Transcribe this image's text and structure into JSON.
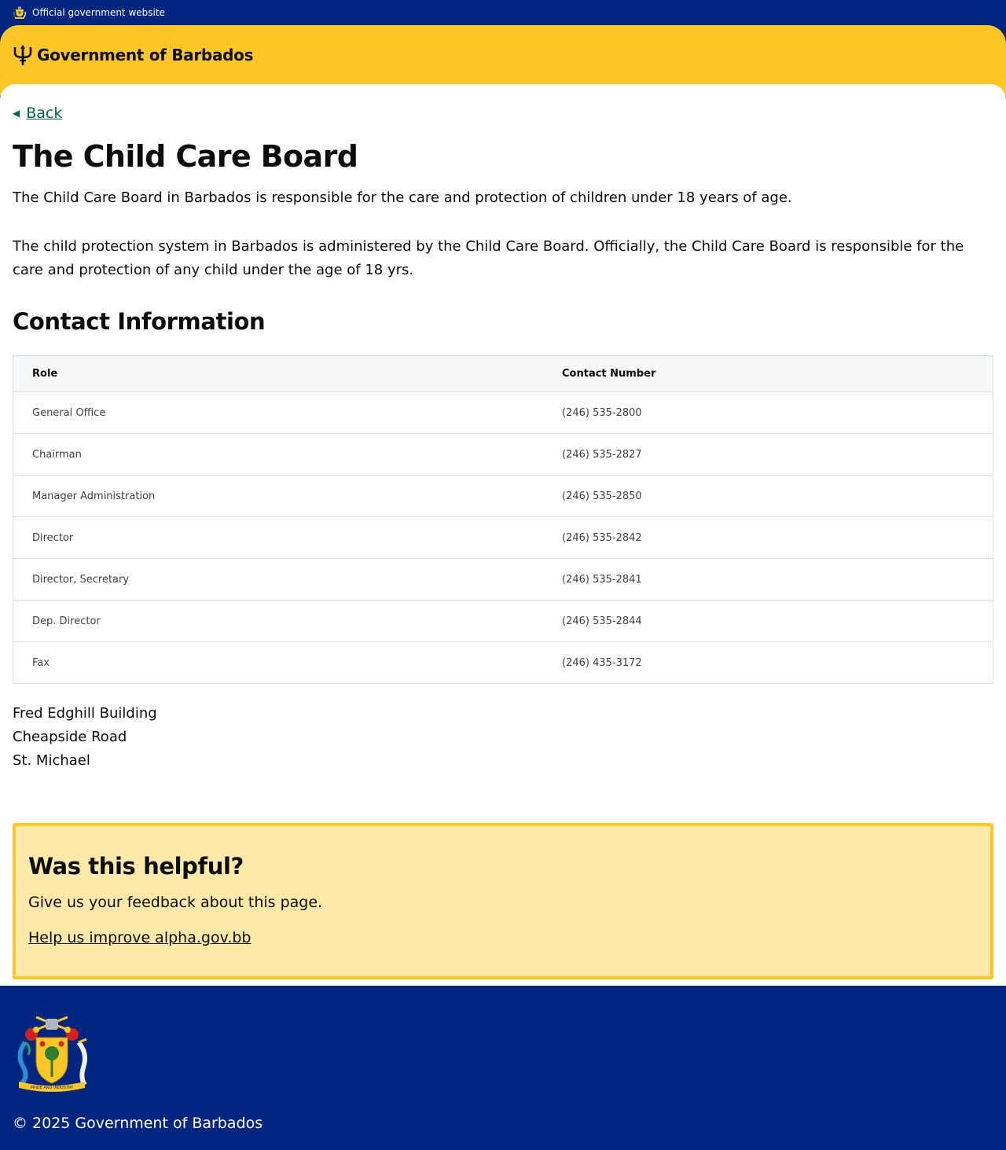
{
  "official_bar": {
    "text": "Official government website",
    "crest_icon": "barbados-crest-icon"
  },
  "header": {
    "brand": "Government of Barbados",
    "logo_icon": "trident-icon",
    "background": "#FFC726"
  },
  "nav": {
    "back_label": "Back",
    "back_icon": "arrow-left-icon"
  },
  "page": {
    "title": "The Child Care Board",
    "paragraphs": [
      "The Child Care Board in Barbados is responsible for the care and protection of children under 18 years of age.",
      "The child protection system in Barbados is administered by the Child Care Board. Officially, the Child Care Board is responsible for the care and protection of any child under the age of 18 yrs."
    ],
    "contact_heading": "Contact Information"
  },
  "contact_table": {
    "headers": [
      "Role",
      "Contact Number"
    ],
    "rows": [
      [
        "General Office",
        "(246) 535-2800"
      ],
      [
        "Chairman",
        "(246) 535-2827"
      ],
      [
        "Manager Administration",
        "(246) 535-2850"
      ],
      [
        "Director",
        "(246) 535-2842"
      ],
      [
        "Director, Secretary",
        "(246) 535-2841"
      ],
      [
        "Dep. Director",
        "(246) 535-2844"
      ],
      [
        "Fax",
        "(246) 435-3172"
      ]
    ]
  },
  "address": [
    "Fred Edghill Building",
    "Cheapside Road",
    "St. Michael"
  ],
  "feedback": {
    "heading": "Was this helpful?",
    "text": "Give us your feedback about this page.",
    "link": "Help us improve alpha.gov.bb"
  },
  "footer": {
    "copyright": "© 2025 Government of Barbados",
    "coat_of_arms_icon": "barbados-coat-of-arms-icon",
    "motto": "PRIDE AND INDUSTRY"
  },
  "colors": {
    "navy": "#00267F",
    "gold": "#FFC726",
    "feedback_bg": "#FFE9A8",
    "link_green": "#00654A"
  }
}
